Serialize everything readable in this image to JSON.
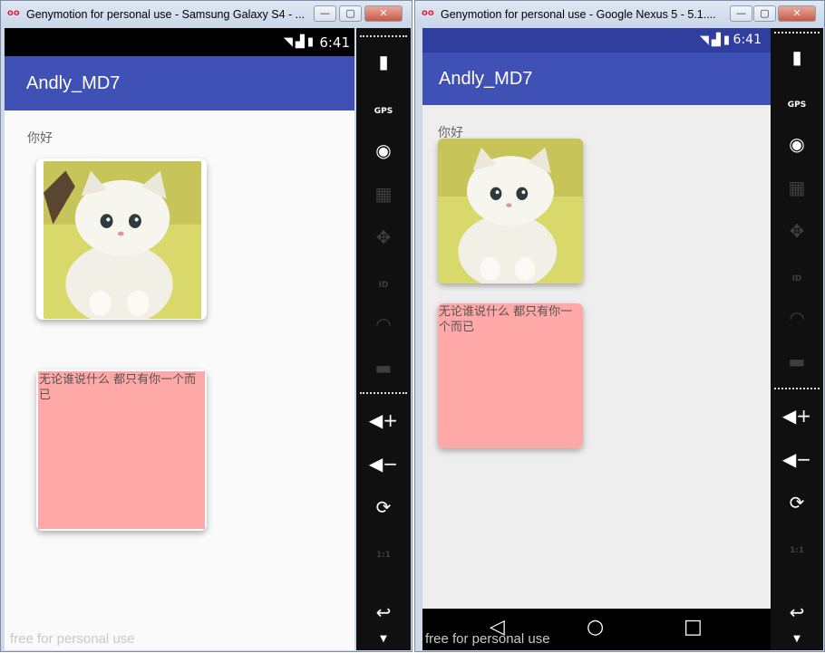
{
  "colors": {
    "primary": "#3f51b5",
    "primary_dark": "#303f9f",
    "card_pink": "#ffa8a8"
  },
  "windows": [
    {
      "title": "Genymotion for personal use - Samsung Galaxy S4 - ...",
      "status_time": "6:41",
      "app_title": "Andly_MD7",
      "greeting": "你好",
      "card_text": "无论谁说什么 都只有你一个而已",
      "watermark": "free for personal use"
    },
    {
      "title": "Genymotion for personal use - Google Nexus 5 - 5.1....",
      "status_time": "6:41",
      "app_title": "Andly_MD7",
      "greeting": "你好",
      "card_text": "无论谁说什么 都只有你一个而已",
      "watermark": "free for personal use"
    }
  ],
  "titlebar_buttons": {
    "minimize": "—",
    "maximize": "▢",
    "close": "✕"
  },
  "sidebar_icons": [
    "battery-icon",
    "gps-icon",
    "webcam-icon",
    "video-clapper-icon",
    "navigation-pad-icon",
    "id-icon",
    "rss-icon",
    "sms-icon",
    "volume-up-icon",
    "volume-down-icon",
    "rotate-icon",
    "pixel-perfect-icon",
    "back-icon",
    "more-icon"
  ],
  "sidebar_labels": {
    "gps": "GPS",
    "id": "ID",
    "pixel": "1:1"
  },
  "navbar_icons": [
    "nav-back-icon",
    "nav-home-icon",
    "nav-recents-icon"
  ]
}
